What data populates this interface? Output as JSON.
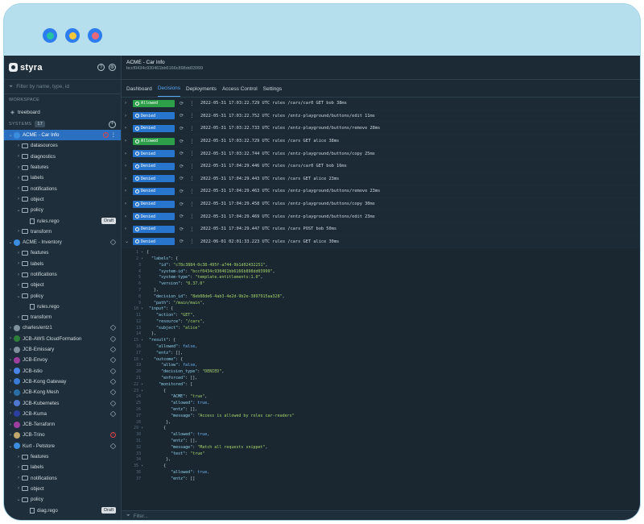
{
  "colors": {
    "frame": "#b6dfee",
    "dot_green": "#25c3a1",
    "dot_yellow": "#f4c63a",
    "dot_red": "#e86a7a",
    "selected": "#2a6fc0",
    "allowed": "#2e9f49",
    "denied": "#2775cc"
  },
  "sidebar": {
    "brand": "styra",
    "filter_placeholder": "Filter by name, type, id",
    "workspace_label": "WORKSPACE",
    "workspace_item": "treeboard",
    "systems_label": "SYSTEMS",
    "systems_count": "17",
    "tree": [
      {
        "label": "ACME - Car Info",
        "level": 0,
        "kind": "system",
        "selected": true,
        "warn": true
      },
      {
        "label": "datasources",
        "level": 1,
        "kind": "folder"
      },
      {
        "label": "diagnostics",
        "level": 1,
        "kind": "folder"
      },
      {
        "label": "features",
        "level": 1,
        "kind": "folder"
      },
      {
        "label": "labels",
        "level": 1,
        "kind": "folder"
      },
      {
        "label": "notifications",
        "level": 1,
        "kind": "folder"
      },
      {
        "label": "object",
        "level": 1,
        "kind": "folder"
      },
      {
        "label": "policy",
        "level": 1,
        "kind": "folder",
        "open": true
      },
      {
        "label": "rules.rego",
        "level": 2,
        "kind": "file",
        "draft": "Draft"
      },
      {
        "label": "transform",
        "level": 1,
        "kind": "folder"
      },
      {
        "label": "ACME - Inventory",
        "level": 0,
        "kind": "system",
        "link": true
      },
      {
        "label": "features",
        "level": 1,
        "kind": "folder"
      },
      {
        "label": "labels",
        "level": 1,
        "kind": "folder"
      },
      {
        "label": "notifications",
        "level": 1,
        "kind": "folder"
      },
      {
        "label": "object",
        "level": 1,
        "kind": "folder"
      },
      {
        "label": "policy",
        "level": 1,
        "kind": "folder",
        "open": true
      },
      {
        "label": "rules.rego",
        "level": 2,
        "kind": "file"
      },
      {
        "label": "transform",
        "level": 1,
        "kind": "folder"
      },
      {
        "label": "charles/entz1",
        "level": 0,
        "kind": "system",
        "link": true
      },
      {
        "label": "JCB-AWS CloudFormation",
        "level": 0,
        "kind": "system",
        "link": true
      },
      {
        "label": "JCB-Emissary",
        "level": 0,
        "kind": "system",
        "link": true
      },
      {
        "label": "JCB-Envoy",
        "level": 0,
        "kind": "system",
        "link": true
      },
      {
        "label": "JCB-istio",
        "level": 0,
        "kind": "system",
        "link": true
      },
      {
        "label": "JCB-Kong Gateway",
        "level": 0,
        "kind": "system",
        "link": true
      },
      {
        "label": "JCB-Kong Mesh",
        "level": 0,
        "kind": "system",
        "link": true
      },
      {
        "label": "JCB-Kubernetes",
        "level": 0,
        "kind": "system",
        "link": true
      },
      {
        "label": "JCB-Kuma",
        "level": 0,
        "kind": "system",
        "link": true
      },
      {
        "label": "JCB-Terraform",
        "level": 0,
        "kind": "system"
      },
      {
        "label": "JCB-Trino",
        "level": 0,
        "kind": "system",
        "warn": true
      },
      {
        "label": "Kurt - Petstore",
        "level": 0,
        "kind": "system",
        "link": true
      },
      {
        "label": "features",
        "level": 1,
        "kind": "folder"
      },
      {
        "label": "labels",
        "level": 1,
        "kind": "folder"
      },
      {
        "label": "notifications",
        "level": 1,
        "kind": "folder"
      },
      {
        "label": "object",
        "level": 1,
        "kind": "folder"
      },
      {
        "label": "policy",
        "level": 1,
        "kind": "folder",
        "open": true
      },
      {
        "label": "diag.rego",
        "level": 2,
        "kind": "file",
        "draft": "Draft"
      }
    ]
  },
  "header": {
    "title": "ACME - Car Info",
    "subtitle": "bccf0434c930461bb6166c898dd03999"
  },
  "tabs": [
    "Dashboard",
    "Decisions",
    "Deployments",
    "Access Control",
    "Settings"
  ],
  "active_tab": "Decisions",
  "decisions": [
    {
      "status": "Allowed",
      "text": "2022-05-31 17:03:22.729 UTC  rules  /cars/car0  GET  bob  38ms"
    },
    {
      "status": "Denied",
      "text": "2022-05-31 17:03:22.752 UTC  rules  /entz-playground/buttons/edit     11ms"
    },
    {
      "status": "Denied",
      "text": "2022-05-31 17:03:22.733 UTC  rules  /entz-playground/buttons/remove     28ms"
    },
    {
      "status": "Allowed",
      "text": "2022-05-31 17:03:22.729 UTC  rules  /cars  GET  alice  38ms"
    },
    {
      "status": "Denied",
      "text": "2022-05-31 17:03:22.744 UTC  rules  /entz-playground/buttons/copy     25ms"
    },
    {
      "status": "Denied",
      "text": "2022-05-31 17:04:29.446 UTC  rules  /cars/car0  GET  bob  16ms"
    },
    {
      "status": "Denied",
      "text": "2022-05-31 17:04:29.443 UTC  rules  /cars  GET  alice  23ms"
    },
    {
      "status": "Denied",
      "text": "2022-05-31 17:04:29.463 UTC  rules  /entz-playground/buttons/remove     23ms"
    },
    {
      "status": "Denied",
      "text": "2022-05-31 17:04:29.458 UTC  rules  /entz-playground/buttons/copy     30ms"
    },
    {
      "status": "Denied",
      "text": "2022-05-31 17:04:29.469 UTC  rules  /entz-playground/buttons/edit     23ms"
    },
    {
      "status": "Denied",
      "text": "2022-05-31 17:04:29.447 UTC  rules  /cars  POST  bob  50ms"
    },
    {
      "status": "Denied",
      "text": "2022-06-01 02:01:33.223 UTC  rules  /cars  GET  alice  30ms",
      "expanded": true
    }
  ],
  "code_lines": [
    "1 ▾ {",
    "2 ▾   \"labels\": {",
    "3       \"id\": \"c78c3884-0c38-495f-a744-9b1d02432251\",",
    "4       \"system-id\": \"bccf0434c930461bb6166b898dd03999\",",
    "5       \"system-type\": \"template.entitlements:1.0\",",
    "6       \"version\": \"0.37.0\"",
    "7     },",
    "8     \"decision_id\": \"8eb88de6-4ab3-4e2d-9b2e-3897915aa328\",",
    "9     \"path\": \"/main/main\",",
    "10 ▾  \"input\": {",
    "11      \"action\": \"GET\",",
    "12      \"resource\": \"/cars\",",
    "13      \"subject\": \"alice\"",
    "14    },",
    "15 ▾  \"result\": {",
    "16      \"allowed\": false,",
    "17      \"entz\": [],",
    "18 ▾    \"outcome\": {",
    "19        \"allow\": false,",
    "20        \"decision_type\": \"DENIED\",",
    "21        \"enforced\": [],",
    "22 ▾      \"monitored\": [",
    "23 ▾        {",
    "24            \"ACME\": \"true\",",
    "25            \"allowed\": true,",
    "26            \"entz\": [],",
    "27            \"message\": \"Access is allowed by roles car-readers\"",
    "28          },",
    "29 ▾        {",
    "30            \"allowed\": true,",
    "31            \"entz\": [],",
    "32            \"message\": \"Match all requests snippet\",",
    "33            \"test\": \"true\"",
    "34          },",
    "35 ▾        {",
    "36            \"allowed\": true,",
    "37            \"entz\": []"
  ],
  "footer_filter": "Filter..."
}
